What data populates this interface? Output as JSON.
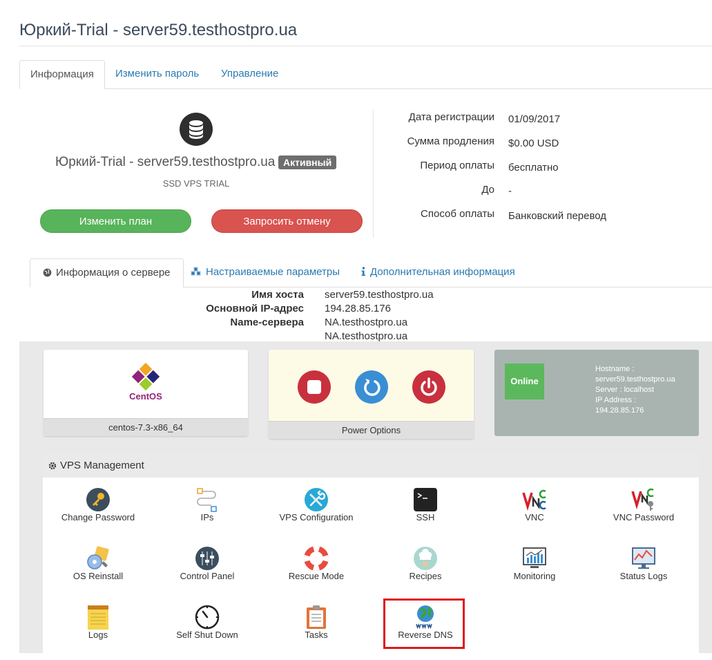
{
  "page": {
    "title": "Юркий-Trial - server59.testhostpro.ua"
  },
  "tabs": [
    {
      "label": "Информация"
    },
    {
      "label": "Изменить пароль"
    },
    {
      "label": "Управление"
    }
  ],
  "product": {
    "name": "Юркий-Trial - server59.testhostpro.ua",
    "status": "Активный",
    "group": "SSD VPS TRIAL",
    "change_plan": "Изменить план",
    "request_cancel": "Запросить отмену"
  },
  "billing": [
    {
      "label": "Дата регистрации",
      "value": "01/09/2017"
    },
    {
      "label": "Сумма продления",
      "value": "$0.00 USD"
    },
    {
      "label": "Период оплаты",
      "value": "бесплатно"
    },
    {
      "label": "До",
      "value": "-"
    },
    {
      "label": "Способ оплаты",
      "value": "Банковский перевод"
    }
  ],
  "server_tabs": [
    {
      "label": "Информация о сервере",
      "icon": "globe-icon"
    },
    {
      "label": "Настраиваемые параметры",
      "icon": "cubes-icon"
    },
    {
      "label": "Дополнительная информация",
      "icon": "info-icon"
    }
  ],
  "server_info": {
    "hostname_label": "Имя хоста",
    "hostname": "server59.testhostpro.ua",
    "ip_label": "Основной IP-адрес",
    "ip": "194.28.85.176",
    "ns_label": "Name-сервера",
    "ns1": "NA.testhostpro.ua",
    "ns2": "NA.testhostpro.ua"
  },
  "os_card": {
    "logo_text": "CentOS",
    "os": "centos-7.3-x86_64"
  },
  "power_card": {
    "label": "Power Options",
    "colors": {
      "stop": "#c9303e",
      "restart": "#3a8ed4",
      "power": "#c9303e"
    }
  },
  "status_card": {
    "state": "Online",
    "line1": "Hostname :",
    "line2": "server59.testhostpro.ua",
    "line3": "Server : localhost",
    "line4": "IP Address :",
    "line5": "194.28.85.176"
  },
  "management": {
    "title": "VPS Management",
    "items": [
      {
        "label": "Change Password",
        "icon": "key-icon"
      },
      {
        "label": "IPs",
        "icon": "network-icon"
      },
      {
        "label": "VPS Configuration",
        "icon": "tools-icon"
      },
      {
        "label": "SSH",
        "icon": "terminal-icon"
      },
      {
        "label": "VNC",
        "icon": "vnc-icon"
      },
      {
        "label": "VNC Password",
        "icon": "vnc-key-icon"
      },
      {
        "label": "OS Reinstall",
        "icon": "os-reinstall-icon"
      },
      {
        "label": "Control Panel",
        "icon": "control-panel-icon"
      },
      {
        "label": "Rescue Mode",
        "icon": "lifebuoy-icon"
      },
      {
        "label": "Recipes",
        "icon": "chef-icon"
      },
      {
        "label": "Monitoring",
        "icon": "monitoring-icon"
      },
      {
        "label": "Status Logs",
        "icon": "status-logs-icon"
      },
      {
        "label": "Logs",
        "icon": "notepad-icon"
      },
      {
        "label": "Self Shut Down",
        "icon": "clock-icon"
      },
      {
        "label": "Tasks",
        "icon": "clipboard-icon"
      },
      {
        "label": "Reverse DNS",
        "icon": "globe-www-icon"
      }
    ]
  },
  "colors": {
    "link": "#2a7ab0",
    "green": "#58b45a",
    "red": "#d9534f",
    "highlight": "#e0171b"
  }
}
